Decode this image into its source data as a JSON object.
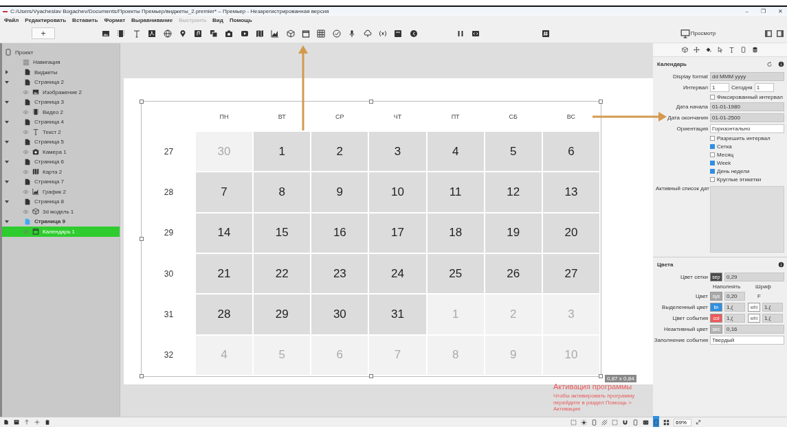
{
  "window": {
    "title": "C:/Users/Vyacheslav Bogachev/Documents/Проекты Премьер/виджеты_2.premier* – Премьер - Незарегистрированная версия",
    "controls": [
      "–",
      "❐",
      "✕"
    ]
  },
  "menu": [
    {
      "label": "Файл",
      "disabled": false
    },
    {
      "label": "Редактировать",
      "disabled": false
    },
    {
      "label": "Вставить",
      "disabled": false
    },
    {
      "label": "Формат",
      "disabled": false
    },
    {
      "label": "Выравнивание",
      "disabled": false
    },
    {
      "label": "Выстроить",
      "disabled": true
    },
    {
      "label": "Вид",
      "disabled": false
    },
    {
      "label": "Помощь",
      "disabled": false
    }
  ],
  "toolbar": {
    "add_button": "+",
    "preview_button": "Просмотр"
  },
  "tree": [
    {
      "label": "Проект",
      "kind": "project",
      "bold": false,
      "selected": false,
      "children": [
        {
          "label": "Навигация",
          "kind": "nav",
          "bold": false,
          "selected": false
        },
        {
          "label": "Виджеты",
          "kind": "page",
          "bold": false,
          "selected": false,
          "expanded": false
        },
        {
          "label": "Страница 2",
          "kind": "page",
          "bold": false,
          "selected": false,
          "expanded": true,
          "children": [
            {
              "label": "Изображение 2",
              "kind": "image",
              "bold": false,
              "selected": false
            }
          ]
        },
        {
          "label": "Страница 3",
          "kind": "page",
          "bold": false,
          "selected": false,
          "expanded": true,
          "children": [
            {
              "label": "Видео 2",
              "kind": "video",
              "bold": false,
              "selected": false
            }
          ]
        },
        {
          "label": "Страница 4",
          "kind": "page",
          "bold": false,
          "selected": false,
          "expanded": true,
          "children": [
            {
              "label": "Текст 2",
              "kind": "text",
              "bold": false,
              "selected": false
            }
          ]
        },
        {
          "label": "Страница 5",
          "kind": "page",
          "bold": false,
          "selected": false,
          "expanded": true,
          "children": [
            {
              "label": "Камера 1",
              "kind": "camera",
              "bold": false,
              "selected": false
            }
          ]
        },
        {
          "label": "Страница 6",
          "kind": "page",
          "bold": false,
          "selected": false,
          "expanded": true,
          "children": [
            {
              "label": "Карта 2",
              "kind": "map",
              "bold": false,
              "selected": false
            }
          ]
        },
        {
          "label": "Страница 7",
          "kind": "page",
          "bold": false,
          "selected": false,
          "expanded": true,
          "children": [
            {
              "label": "График 2",
              "kind": "chart",
              "bold": false,
              "selected": false
            }
          ]
        },
        {
          "label": "Страница 8",
          "kind": "page",
          "bold": false,
          "selected": false,
          "expanded": true,
          "children": [
            {
              "label": "3d модель 1",
              "kind": "model",
              "bold": false,
              "selected": false
            }
          ]
        },
        {
          "label": "Страница 9",
          "kind": "page-active",
          "bold": true,
          "selected": false,
          "expanded": true,
          "children": [
            {
              "label": "Календарь 1",
              "kind": "calendar",
              "bold": false,
              "selected": true
            }
          ]
        }
      ]
    }
  ],
  "calendar": {
    "days": [
      "ПН",
      "ВТ",
      "СР",
      "ЧТ",
      "ПТ",
      "СБ",
      "ВС"
    ],
    "weeks": [
      {
        "number": "27",
        "cells": [
          {
            "label": "30",
            "kind": "other"
          },
          {
            "label": "1",
            "kind": "current"
          },
          {
            "label": "2",
            "kind": "current"
          },
          {
            "label": "3",
            "kind": "current"
          },
          {
            "label": "4",
            "kind": "current"
          },
          {
            "label": "5",
            "kind": "current"
          },
          {
            "label": "6",
            "kind": "current"
          }
        ]
      },
      {
        "number": "28",
        "cells": [
          {
            "label": "7",
            "kind": "current"
          },
          {
            "label": "8",
            "kind": "current"
          },
          {
            "label": "9",
            "kind": "current"
          },
          {
            "label": "10",
            "kind": "current"
          },
          {
            "label": "11",
            "kind": "current"
          },
          {
            "label": "12",
            "kind": "current"
          },
          {
            "label": "13",
            "kind": "current"
          }
        ]
      },
      {
        "number": "29",
        "cells": [
          {
            "label": "14",
            "kind": "current"
          },
          {
            "label": "15",
            "kind": "current"
          },
          {
            "label": "16",
            "kind": "current"
          },
          {
            "label": "17",
            "kind": "current"
          },
          {
            "label": "18",
            "kind": "current"
          },
          {
            "label": "19",
            "kind": "current"
          },
          {
            "label": "20",
            "kind": "current"
          }
        ]
      },
      {
        "number": "30",
        "cells": [
          {
            "label": "21",
            "kind": "current"
          },
          {
            "label": "22",
            "kind": "current"
          },
          {
            "label": "23",
            "kind": "current"
          },
          {
            "label": "24",
            "kind": "current"
          },
          {
            "label": "25",
            "kind": "current"
          },
          {
            "label": "26",
            "kind": "current"
          },
          {
            "label": "27",
            "kind": "current"
          }
        ]
      },
      {
        "number": "31",
        "cells": [
          {
            "label": "28",
            "kind": "current"
          },
          {
            "label": "29",
            "kind": "current"
          },
          {
            "label": "30",
            "kind": "current"
          },
          {
            "label": "31",
            "kind": "current"
          },
          {
            "label": "1",
            "kind": "other"
          },
          {
            "label": "2",
            "kind": "other"
          },
          {
            "label": "3",
            "kind": "other"
          }
        ]
      },
      {
        "number": "32",
        "cells": [
          {
            "label": "4",
            "kind": "other"
          },
          {
            "label": "5",
            "kind": "other"
          },
          {
            "label": "6",
            "kind": "other"
          },
          {
            "label": "7",
            "kind": "other"
          },
          {
            "label": "8",
            "kind": "other"
          },
          {
            "label": "9",
            "kind": "other"
          },
          {
            "label": "10",
            "kind": "other"
          }
        ]
      }
    ],
    "size_label": "0,87 x 0,84"
  },
  "activation": {
    "title": "Активация программы",
    "text": "Чтобы активировать программу перейдите в раздел Помощь > Активация"
  },
  "properties": {
    "title": "Календарь",
    "rows": [
      {
        "kind": "text",
        "label": "Display format",
        "value": "dd MMM yyyy"
      },
      {
        "kind": "spin2",
        "label": "Интервал",
        "value": "1",
        "label2": "Сегодня",
        "value2": "1"
      },
      {
        "kind": "check",
        "label": "Фиксированный интервал",
        "checked": false
      },
      {
        "kind": "spin",
        "label": "Дата начала",
        "value": "01-01-1980"
      },
      {
        "kind": "spin",
        "label": "Дата окончания",
        "value": "01-01-2500"
      },
      {
        "kind": "select",
        "label": "Ориентация",
        "value": "Горизонтально"
      },
      {
        "kind": "check",
        "label": "Разрешить интервал",
        "checked": false
      },
      {
        "kind": "check",
        "label": "Сетка",
        "checked": true
      },
      {
        "kind": "check",
        "label": "Месяц",
        "checked": false
      },
      {
        "kind": "check",
        "label": "Week",
        "checked": true
      },
      {
        "kind": "check",
        "label": "День недели",
        "checked": true
      },
      {
        "kind": "check",
        "label": "Круглые этикетки",
        "checked": false
      },
      {
        "kind": "list",
        "label": "Активный список дат"
      }
    ]
  },
  "colors": {
    "title": "Цвета",
    "rows": [
      {
        "kind": "wide",
        "label": "Цвет сетки",
        "swatch": "sep",
        "color": "#4a4a4a",
        "value": "0,29"
      },
      {
        "kind": "headers",
        "label": "Наполнять",
        "label2": "Шриф"
      },
      {
        "kind": "pair",
        "label": "Цвет",
        "swatch": "sys",
        "color": "#a8a8a8",
        "value": "0,20",
        "font_letter": "F"
      },
      {
        "kind": "pair",
        "label": "Выделенный цвет",
        "swatch": "lin",
        "color": "#2f8fe0",
        "value": "1,(",
        "swatch2": "whi",
        "value2": "1,("
      },
      {
        "kind": "pair",
        "label": "Цвет события",
        "swatch": "col",
        "color": "#ef5a5a",
        "value": "1,(",
        "swatch2": "whi",
        "value2": "1,("
      },
      {
        "kind": "wide",
        "label": "Неактивный цвет",
        "swatch": "sec",
        "color": "#b5b5b5",
        "value": "0,16"
      },
      {
        "kind": "select",
        "label": "Заполнение события",
        "value": "Твердый"
      }
    ]
  },
  "status_bar": {
    "zoom": "69%"
  }
}
